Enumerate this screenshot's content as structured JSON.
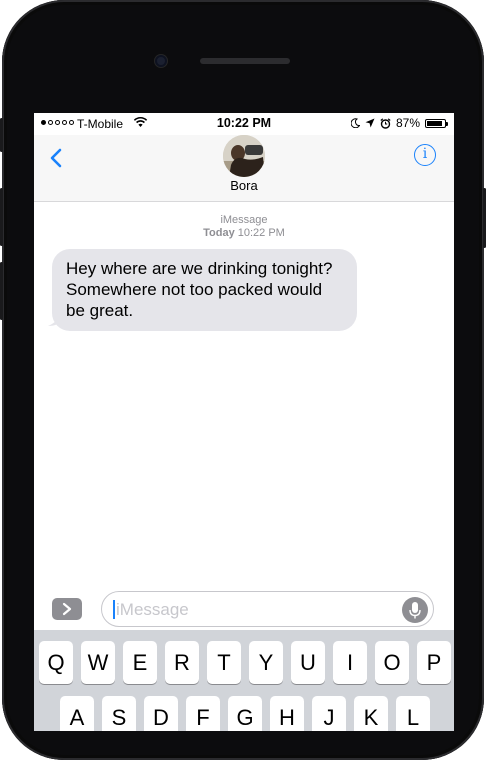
{
  "status_bar": {
    "carrier": "T-Mobile",
    "time": "10:22 PM",
    "battery": "87%",
    "battery_level": 0.87,
    "signal_dots": [
      true,
      false,
      false,
      false,
      false
    ]
  },
  "header": {
    "contact_name": "Bora"
  },
  "conversation": {
    "service": "iMessage",
    "day": "Today",
    "time": "10:22 PM",
    "messages": [
      {
        "text": "Hey where are we drinking tonight? Somewhere not too packed would be great."
      }
    ]
  },
  "input": {
    "placeholder": "iMessage"
  },
  "keyboard": {
    "row1": [
      "Q",
      "W",
      "E",
      "R",
      "T",
      "Y",
      "U",
      "I",
      "O",
      "P"
    ],
    "row2": [
      "A",
      "S",
      "D",
      "F",
      "G",
      "H",
      "J",
      "K",
      "L"
    ]
  },
  "colors": {
    "accent": "#1a82fb",
    "bubble": "#e5e5ea",
    "keyboard_bg": "#d1d4d9"
  },
  "icons": [
    "back-chevron-icon",
    "info-icon",
    "wifi-icon",
    "moon-icon",
    "location-arrow-icon",
    "alarm-icon",
    "battery-icon",
    "app-drawer-icon",
    "microphone-icon"
  ]
}
